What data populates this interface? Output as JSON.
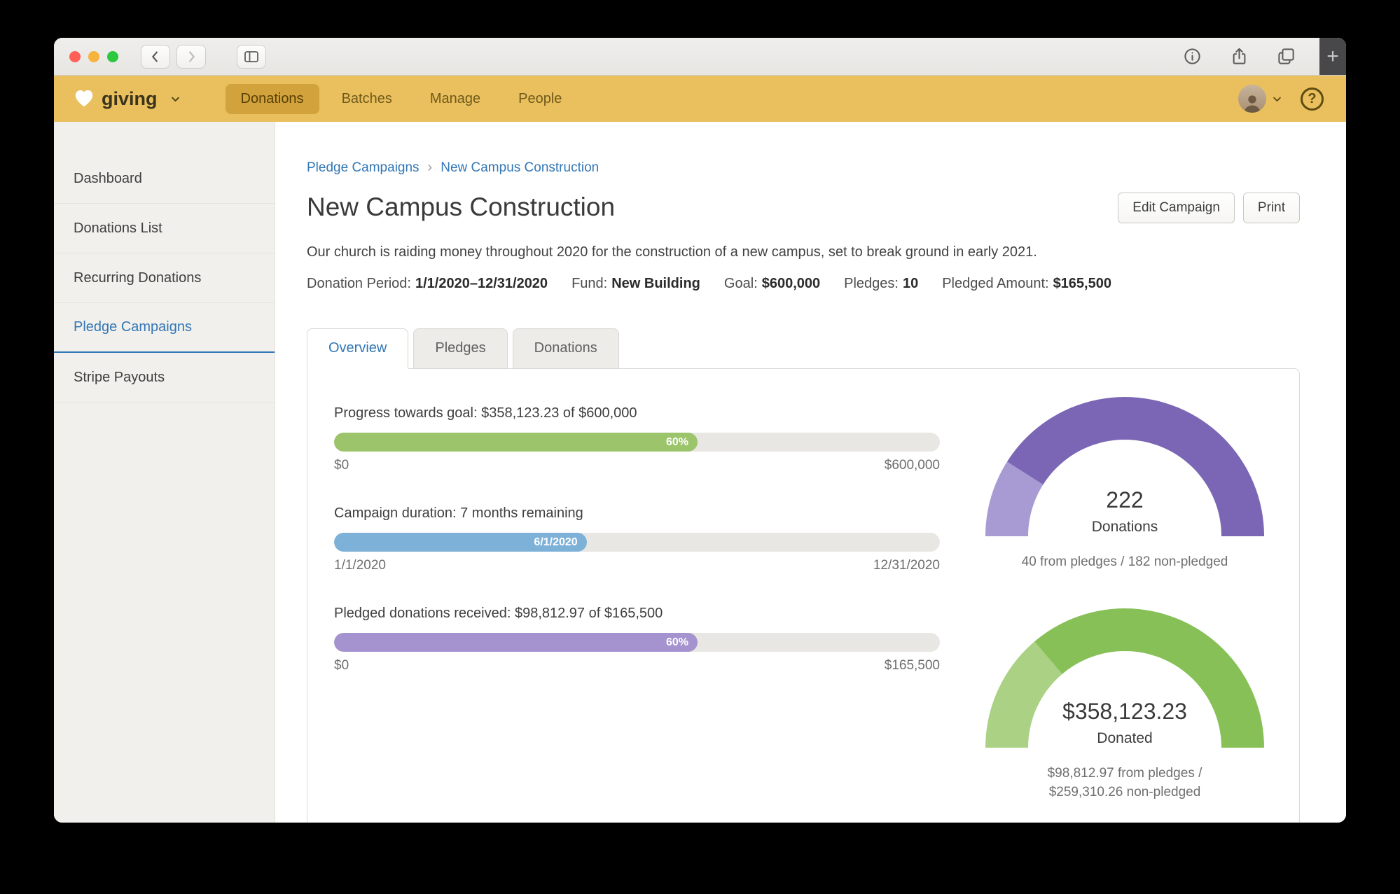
{
  "browser": {
    "new_tab_label": "+"
  },
  "nav": {
    "brand": "giving",
    "items": [
      {
        "label": "Donations",
        "active": true
      },
      {
        "label": "Batches"
      },
      {
        "label": "Manage"
      },
      {
        "label": "People"
      }
    ],
    "help_label": "?"
  },
  "sidebar": {
    "items": [
      {
        "label": "Dashboard"
      },
      {
        "label": "Donations List"
      },
      {
        "label": "Recurring Donations"
      },
      {
        "label": "Pledge Campaigns",
        "active": true
      },
      {
        "label": "Stripe Payouts"
      }
    ]
  },
  "breadcrumb": {
    "parent": "Pledge Campaigns",
    "separator": "›",
    "current": "New Campus Construction"
  },
  "page": {
    "title": "New Campus Construction",
    "description": "Our church is raiding money throughout 2020 for the construction of a new campus, set to break ground in early 2021.",
    "actions": {
      "edit": "Edit Campaign",
      "print": "Print"
    }
  },
  "meta": {
    "items": [
      {
        "label": "Donation Period:",
        "value": "1/1/2020–12/31/2020"
      },
      {
        "label": "Fund:",
        "value": "New Building"
      },
      {
        "label": "Goal:",
        "value": "$600,000"
      },
      {
        "label": "Pledges:",
        "value": "10"
      },
      {
        "label": "Pledged Amount:",
        "value": "$165,500"
      }
    ]
  },
  "tabs": {
    "items": [
      {
        "label": "Overview",
        "active": true
      },
      {
        "label": "Pledges"
      },
      {
        "label": "Donations"
      }
    ]
  },
  "chart_data": {
    "type": "progress-bars-and-gauges",
    "bars": [
      {
        "title": "Progress towards goal: $358,123.23 of $600,000",
        "percent": 60,
        "fill_label": "60%",
        "color": "#9cc46a",
        "scale_min": "$0",
        "scale_max": "$600,000"
      },
      {
        "title": "Campaign duration: 7 months remaining",
        "percent": 41.7,
        "fill_label": "6/1/2020",
        "color": "#7eb1d8",
        "scale_min": "1/1/2020",
        "scale_max": "12/31/2020"
      },
      {
        "title": "Pledged donations received: $98,812.97 of $165,500",
        "percent": 60,
        "fill_label": "60%",
        "color": "#a493cf",
        "scale_min": "$0",
        "scale_max": "$165,500"
      }
    ],
    "gauges": [
      {
        "value": "222",
        "label": "Donations",
        "caption_lines": [
          "40 from pledges / 182 non-pledged"
        ],
        "light_fraction": 0.18,
        "color": "#7a66b4",
        "light_color": "#a89bd4"
      },
      {
        "value": "$358,123.23",
        "label": "Donated",
        "caption_lines": [
          "$98,812.97 from pledges /",
          "$259,310.26 non-pledged"
        ],
        "light_fraction": 0.276,
        "color": "#87c057",
        "light_color": "#abd284"
      }
    ]
  },
  "colors": {
    "brand_gold": "#e9c05d",
    "link_blue": "#3377b5"
  }
}
